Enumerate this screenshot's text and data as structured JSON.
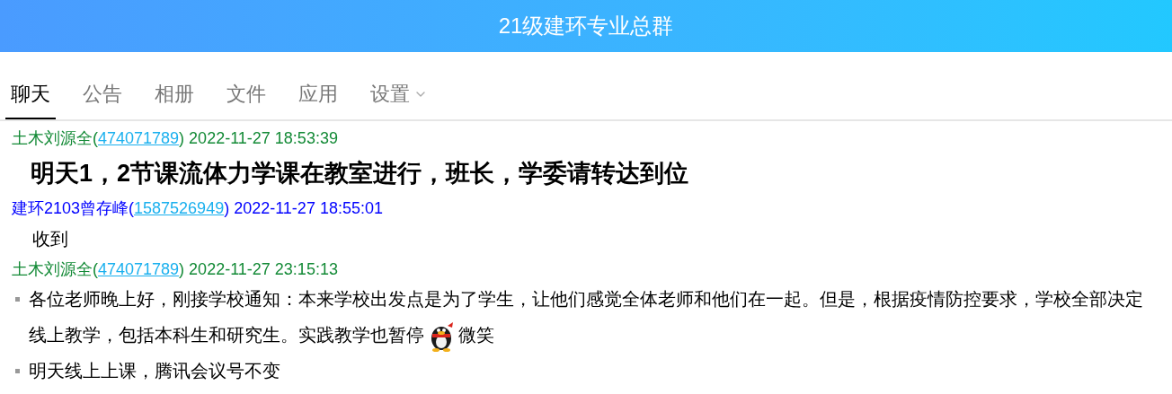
{
  "window": {
    "title": "21级建环专业总群"
  },
  "tabs": [
    {
      "label": "聊天",
      "selected": true
    },
    {
      "label": "公告",
      "selected": false
    },
    {
      "label": "相册",
      "selected": false
    },
    {
      "label": "文件",
      "selected": false
    },
    {
      "label": "应用",
      "selected": false
    },
    {
      "label": "设置",
      "selected": false,
      "dropdown": true
    }
  ],
  "messages": [
    {
      "sender": "土木刘源全(",
      "qq": "474071789",
      "time": ") 2022-11-27 18:53:39",
      "color": "#138a36",
      "kind": "bold",
      "text": "明天1，2节课流体力学课在教室进行，班长，学委请转达到位"
    },
    {
      "sender": "建环2103曾存峰(",
      "qq": "1587526949",
      "time": ") 2022-11-27 18:55:01",
      "color": "#0000ff",
      "kind": "plain",
      "text": "收到"
    },
    {
      "sender": "土木刘源全(",
      "qq": "474071789",
      "time": ") 2022-11-27 23:15:13",
      "color": "#138a36",
      "kind": "bullets",
      "items": [
        {
          "text": "各位老师晚上好，刚接学校通知：本来学校出发点是为了学生，让他们感觉全体老师和他们在一起。但是，根据疫情防控要求，学校全部决定线上教学，包括本科生和研究生。实践教学也暂停",
          "emoji": "微笑"
        },
        {
          "text": "明天线上上课，腾讯会议号不变"
        }
      ]
    }
  ]
}
